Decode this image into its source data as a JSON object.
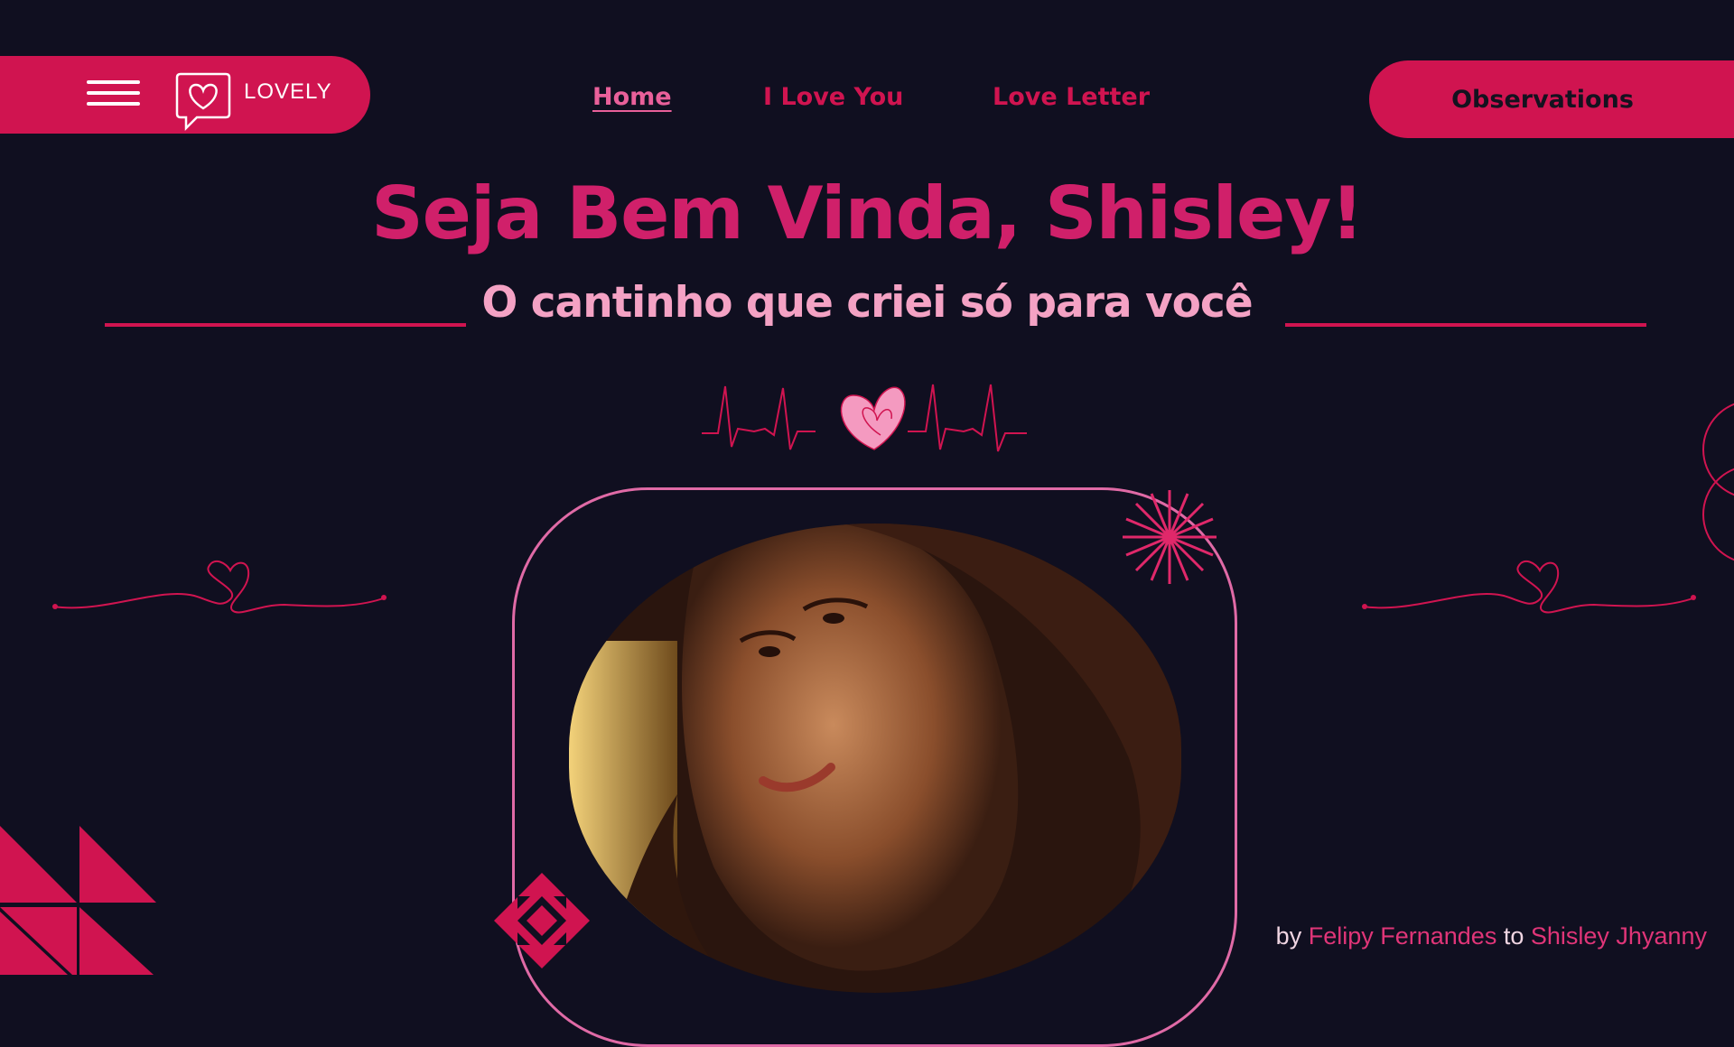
{
  "header": {
    "logo_text": "LOVELY",
    "nav": [
      {
        "label": "Home",
        "active": true
      },
      {
        "label": "I Love You",
        "active": false
      },
      {
        "label": "Love Letter",
        "active": false
      }
    ],
    "observations_label": "Observations"
  },
  "hero": {
    "title": "Seja Bem Vinda, Shisley!",
    "subtitle": "O cantinho que criei só para você"
  },
  "footer": {
    "by": "by",
    "author": "Felipy Fernandes",
    "to": "to",
    "recipient": "Shisley Jhyanny"
  },
  "colors": {
    "background": "#100f20",
    "accent": "#d01450",
    "light_pink": "#f4a2c4"
  }
}
